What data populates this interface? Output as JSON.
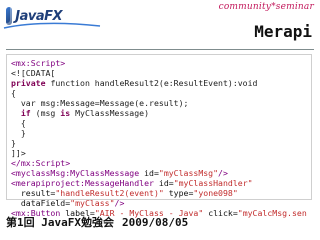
{
  "header": {
    "logo_text": "JavaFX",
    "community_tag": "community*seminar",
    "product_name": "Merapi"
  },
  "code": {
    "lines": [
      [
        {
          "t": "<mx:Script>",
          "c": "tag"
        }
      ],
      [
        {
          "t": "<![CDATA[",
          "c": "plain"
        }
      ],
      [
        {
          "t": "private",
          "c": "kw"
        },
        {
          "t": " function handleResult2(e:ResultEvent):void",
          "c": "plain"
        }
      ],
      [
        {
          "t": "{",
          "c": "plain"
        }
      ],
      [
        {
          "t": "  var msg:Message=Message(e.result);",
          "c": "plain"
        }
      ],
      [
        {
          "t": "  if",
          "c": "kw"
        },
        {
          "t": " (msg ",
          "c": "plain"
        },
        {
          "t": "is",
          "c": "kw"
        },
        {
          "t": " MyClassMessage)",
          "c": "plain"
        }
      ],
      [
        {
          "t": "  {",
          "c": "plain"
        }
      ],
      [
        {
          "t": "  }",
          "c": "plain"
        }
      ],
      [
        {
          "t": "}",
          "c": "plain"
        }
      ],
      [
        {
          "t": "]]>",
          "c": "plain"
        }
      ],
      [
        {
          "t": "</mx:Script>",
          "c": "tag"
        }
      ],
      [
        {
          "t": "<myclassMsg:MyClassMessage ",
          "c": "tag"
        },
        {
          "t": "id=",
          "c": "attr"
        },
        {
          "t": "\"myClassMsg\"",
          "c": "str"
        },
        {
          "t": "/>",
          "c": "tag"
        }
      ],
      [
        {
          "t": "<merapiproject:MessageHandler ",
          "c": "tag"
        },
        {
          "t": "id=",
          "c": "attr"
        },
        {
          "t": "\"myClassHandler\"",
          "c": "str"
        }
      ],
      [
        {
          "t": "  result=",
          "c": "attr"
        },
        {
          "t": "\"handleResult2(event)\" ",
          "c": "str"
        },
        {
          "t": "type=",
          "c": "attr"
        },
        {
          "t": "\"yone098\"",
          "c": "str"
        }
      ],
      [
        {
          "t": "  dataField=",
          "c": "attr"
        },
        {
          "t": "\"myClass\"",
          "c": "str"
        },
        {
          "t": "/>",
          "c": "tag"
        }
      ],
      [
        {
          "t": "<mx:Button ",
          "c": "tag"
        },
        {
          "t": "label=",
          "c": "attr"
        },
        {
          "t": "\"AIR - MyClass - Java\" ",
          "c": "str"
        },
        {
          "t": "click=",
          "c": "attr"
        },
        {
          "t": "\"myCalcMsg.send()\"",
          "c": "str"
        },
        {
          "t": "/>",
          "c": "tag"
        }
      ]
    ]
  },
  "footer": {
    "title": "第1回 JavaFX勉強会",
    "date": "2009/08/05"
  },
  "colors": {
    "tag": "#800080",
    "keyword": "#7f0055",
    "string": "#c22d2d",
    "community": "#c2185b",
    "logo_blue": "#1f3f7a"
  }
}
